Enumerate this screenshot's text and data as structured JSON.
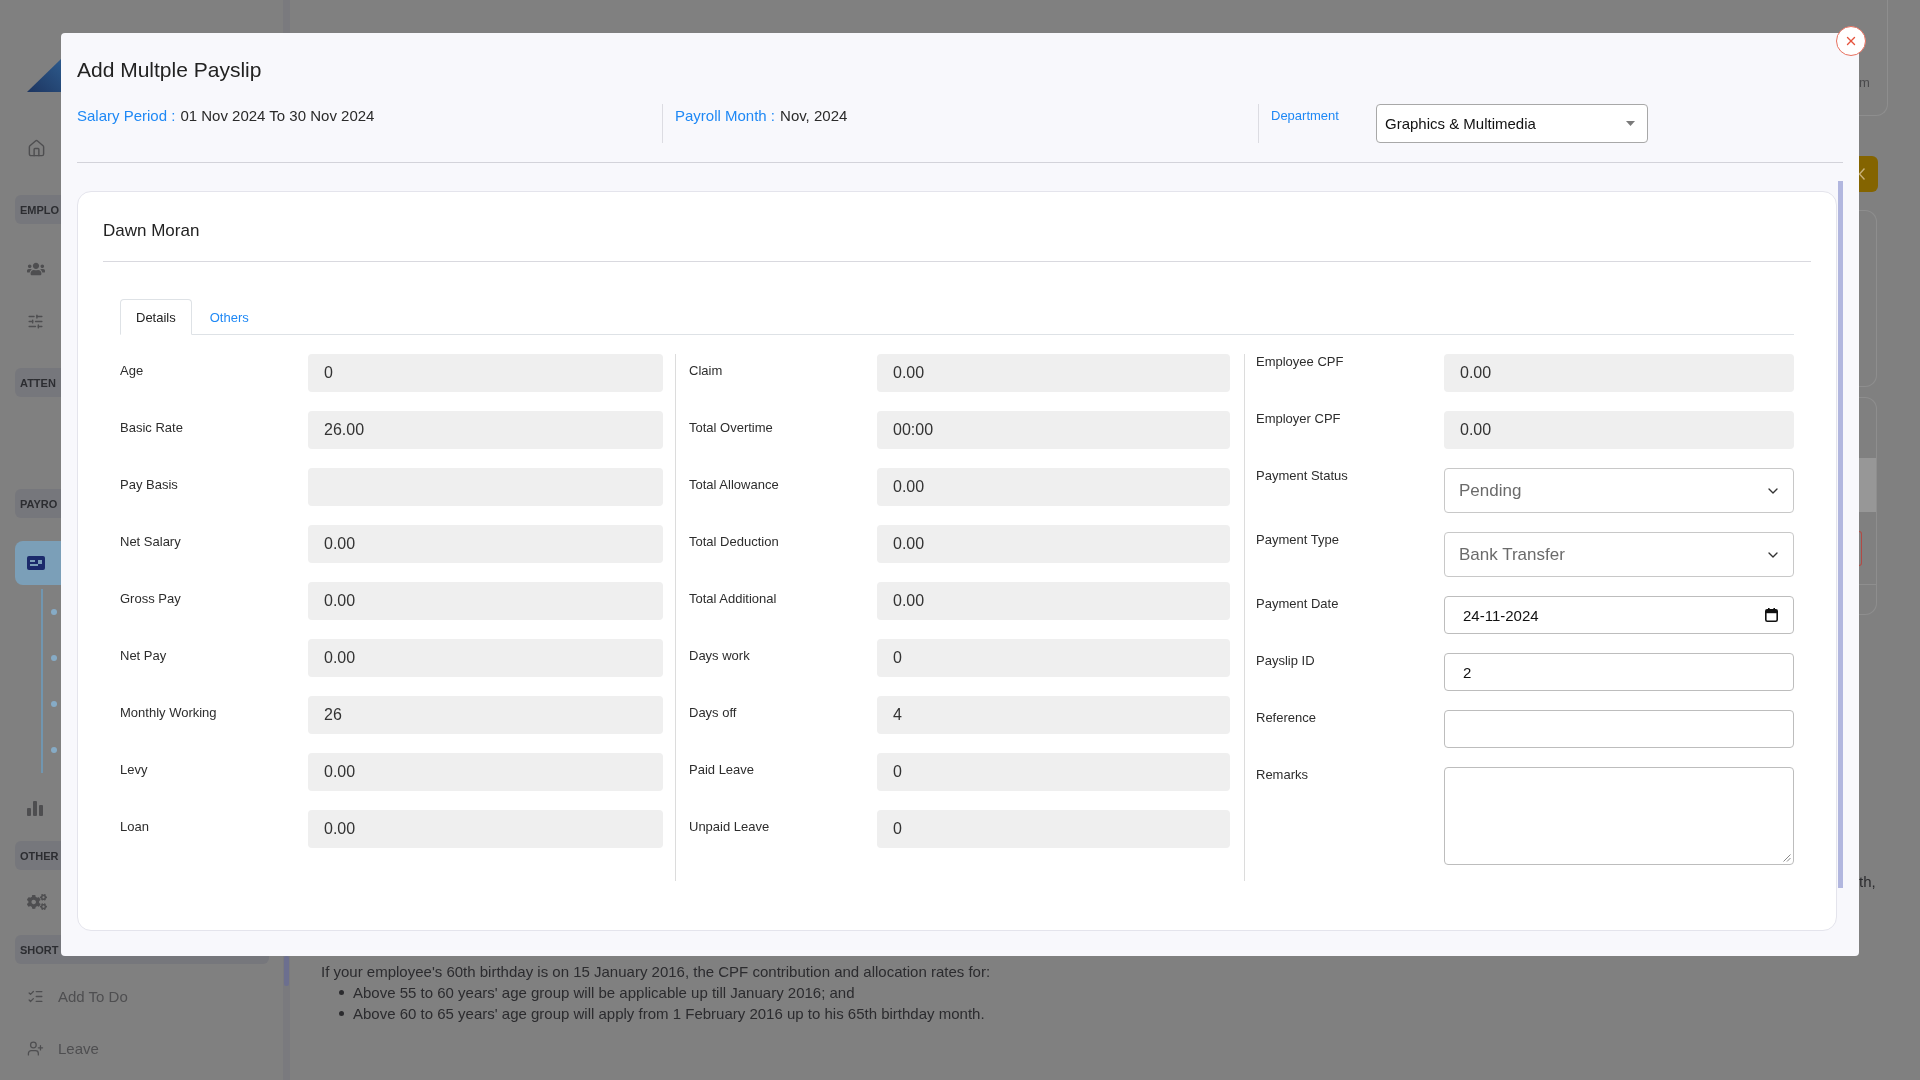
{
  "sidebar": {
    "sections": [
      {
        "items": [
          {
            "selected": false
          }
        ]
      },
      {
        "heading": "EMPLO",
        "items": [
          {
            "selected": false
          },
          {
            "selected": false
          }
        ]
      },
      {
        "heading": "ATTEN"
      },
      {
        "heading": "PAYRO",
        "items": [
          {
            "selected": true,
            "expanded": true
          },
          {
            "selected": false,
            "expanded": false
          }
        ]
      },
      {
        "heading": "OTHER",
        "items": [
          {
            "selected": false
          }
        ]
      },
      {
        "heading": "SHORT",
        "items": [
          {
            "label": "Add To Do",
            "selected": false
          },
          {
            "label": "Leave",
            "selected": false
          }
        ]
      }
    ]
  },
  "page": {
    "header_card_text": "m",
    "note": {
      "intro": "If your employee's 60th birthday is on 15 January 2016, the CPF contribution and allocation rates for:",
      "bullets": [
        "Above 55 to 60 years' age group will be applicable up till January 2016; and",
        "Above 60 to 65 years' age group will apply from 1 February 2016 up to his 65th birthday month."
      ]
    },
    "right_edge_text": "th,"
  },
  "modal": {
    "title": "Add Multple Payslip",
    "salary_period": {
      "label": "Salary Period :",
      "value": "01 Nov 2024 To 30 Nov 2024"
    },
    "payroll_month": {
      "label": "Payroll Month :",
      "value": "Nov, 2024"
    },
    "department": {
      "label": "Department",
      "value": "Graphics & Multimedia"
    },
    "employee": {
      "name": "Dawn Moran",
      "tabs": [
        {
          "label": "Details",
          "selected": true
        },
        {
          "label": "Others",
          "selected": false
        }
      ],
      "columns": [
        {
          "fields": [
            {
              "kind": "readonly",
              "label": "Age",
              "value": "0"
            },
            {
              "kind": "readonly",
              "label": "Basic Rate",
              "value": "26.00"
            },
            {
              "kind": "readonly",
              "label": "Pay Basis"
            },
            {
              "kind": "readonly",
              "label": "Net Salary",
              "value": "0.00"
            },
            {
              "kind": "readonly",
              "label": "Gross Pay",
              "value": "0.00"
            },
            {
              "kind": "readonly",
              "label": "Net Pay",
              "value": "0.00"
            },
            {
              "kind": "readonly",
              "label": "Monthly Working",
              "value": "26"
            },
            {
              "kind": "readonly",
              "label": "Levy",
              "value": "0.00"
            },
            {
              "kind": "readonly",
              "label": "Loan",
              "value": "0.00"
            }
          ]
        },
        {
          "fields": [
            {
              "kind": "readonly",
              "label": "Claim",
              "value": "0.00"
            },
            {
              "kind": "readonly",
              "label": "Total Overtime",
              "value": "00:00"
            },
            {
              "kind": "readonly",
              "label": "Total Allowance",
              "value": "0.00"
            },
            {
              "kind": "readonly",
              "label": "Total Deduction",
              "value": "0.00"
            },
            {
              "kind": "readonly",
              "label": "Total Additional",
              "value": "0.00"
            },
            {
              "kind": "readonly",
              "label": "Days work",
              "value": "0"
            },
            {
              "kind": "readonly",
              "label": "Days off",
              "value": "4"
            },
            {
              "kind": "readonly",
              "label": "Paid Leave",
              "value": "0"
            },
            {
              "kind": "readonly",
              "label": "Unpaid Leave",
              "value": "0"
            }
          ]
        },
        {
          "fields": [
            {
              "kind": "readonly",
              "label": "Employee CPF",
              "value": "0.00"
            },
            {
              "kind": "readonly",
              "label": "Employer CPF",
              "value": "0.00"
            },
            {
              "kind": "select",
              "label": "Payment Status",
              "value": "Pending"
            },
            {
              "kind": "select",
              "label": "Payment Type",
              "value": "Bank Transfer"
            },
            {
              "kind": "date",
              "label": "Payment Date",
              "value": "24-11-2024"
            },
            {
              "kind": "text",
              "label": "Payslip ID",
              "value": "2"
            },
            {
              "kind": "text",
              "label": "Reference"
            },
            {
              "kind": "textarea",
              "label": "Remarks"
            }
          ]
        }
      ]
    }
  }
}
